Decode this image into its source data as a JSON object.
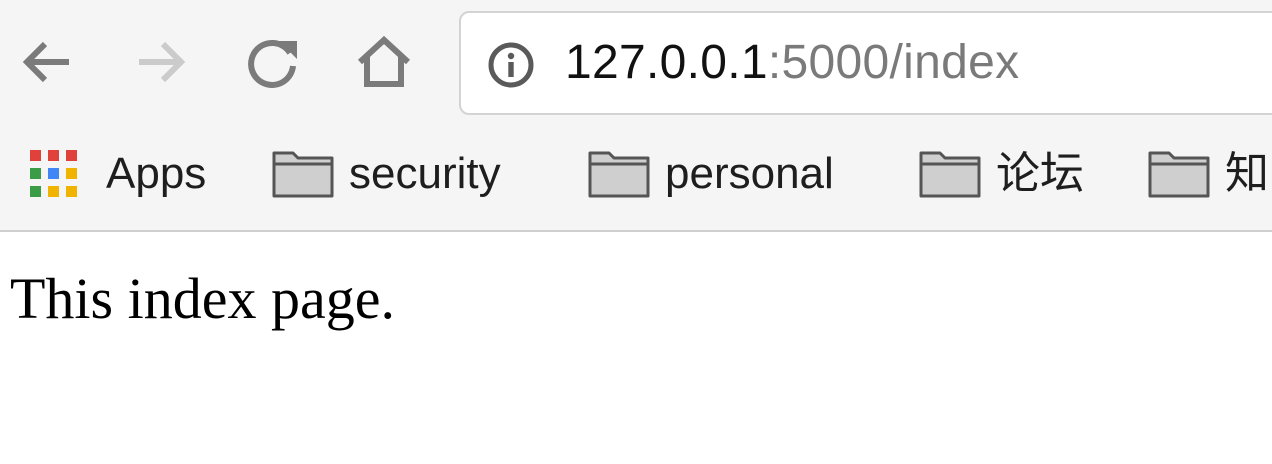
{
  "toolbar": {
    "back_icon": "back-arrow-icon",
    "forward_icon": "forward-arrow-icon",
    "reload_icon": "reload-icon",
    "home_icon": "home-icon"
  },
  "omnibox": {
    "security_icon": "info-icon",
    "url_host": "127.0.0.1",
    "url_rest": ":5000/index"
  },
  "bookmarks": {
    "apps_label": "Apps",
    "items": [
      {
        "label": "security",
        "icon": "folder-icon"
      },
      {
        "label": "personal",
        "icon": "folder-icon"
      },
      {
        "label": "论坛",
        "icon": "folder-icon"
      },
      {
        "label": "知",
        "icon": "folder-icon"
      }
    ]
  },
  "page": {
    "text": "This index page."
  },
  "colors": {
    "toolbar_bg": "#f5f5f5",
    "url_host": "#111111",
    "url_rest": "#7a7a7a",
    "icon_active": "#777777",
    "icon_disabled": "#c8c8c8"
  }
}
